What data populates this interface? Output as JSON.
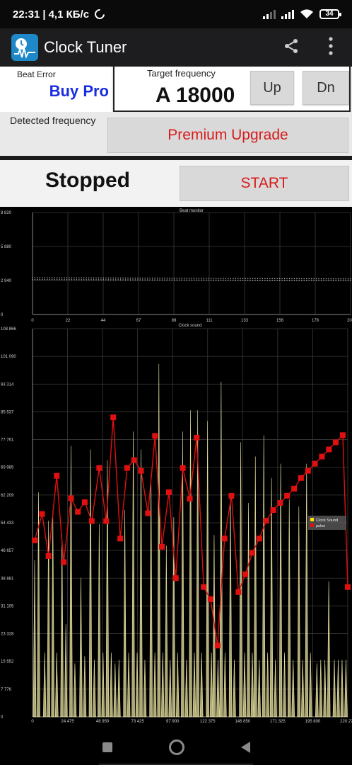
{
  "status_bar": {
    "time": "22:31",
    "net_speed": "4,1 КБ/с",
    "battery": "34"
  },
  "app": {
    "title": "Clock Tuner"
  },
  "controls": {
    "beat_error_label": "Beat Error",
    "buy_pro": "Buy Pro",
    "target_freq_label": "Target frequency",
    "target_freq_value": "A 18000",
    "up_label": "Up",
    "down_label": "Dn",
    "detected_freq_label": "Detected frequency",
    "premium_label": "Premium Upgrade",
    "state": "Stopped",
    "start_label": "START"
  },
  "colors": {
    "accent_red": "#d81b1b",
    "buy_pro_blue": "#1a2de0",
    "pulse": "#e01010",
    "clock_sound": "#e8e2a0"
  },
  "chart_data": [
    {
      "type": "scatter",
      "title": "Beat monitor",
      "x_ticks": [
        "0",
        "22",
        "44",
        "67",
        "89",
        "111",
        "133",
        "156",
        "178",
        "200"
      ],
      "y_ticks": [
        "8 820",
        "5 880",
        "2 940",
        "0"
      ],
      "xlim": [
        0,
        200
      ],
      "ylim": [
        0,
        8820
      ],
      "series": [
        {
          "values_start": 3180,
          "values_end": 3080
        },
        {
          "values_start": 3020,
          "values_end": 2940
        }
      ],
      "grid": true
    },
    {
      "type": "line",
      "title": "Clock sound",
      "x_ticks": [
        "0",
        "24 475",
        "48 950",
        "73 425",
        "97 900",
        "122 375",
        "146 850",
        "171 325",
        "195 800",
        "220 275"
      ],
      "y_ticks": [
        "108 866",
        "101 090",
        "93 314",
        "85 537",
        "77 761",
        "69 985",
        "62 209",
        "54 433",
        "46 657",
        "38 881",
        "31 105",
        "23 328",
        "15 552",
        "7 776",
        "0"
      ],
      "xlim": [
        0,
        220275
      ],
      "ylim": [
        0,
        108866
      ],
      "legend": {
        "position": "right",
        "entries": [
          "Clock Sound",
          "pulse"
        ]
      },
      "series": [
        {
          "name": "Clock Sound",
          "x": [
            1500,
            4200,
            8500,
            11200,
            14200,
            16900,
            20600,
            23300,
            26900,
            29600,
            33800,
            36500,
            40500,
            43200,
            46600,
            49300,
            52300,
            55000,
            57700,
            60400,
            64500,
            67200,
            70400,
            73100,
            75800,
            78500,
            82800,
            85500,
            88300,
            91000,
            93500,
            96200,
            98700,
            101400,
            104900,
            107600,
            110400,
            113100,
            115400,
            118100,
            122300,
            125000,
            126900,
            129600,
            131800,
            134500,
            138300,
            141000,
            145500,
            148200,
            150900,
            153600,
            155700,
            158400,
            161600,
            164300,
            167000,
            169700,
            173400,
            176100,
            179400,
            182100,
            186100,
            188800,
            191500,
            194200,
            198700,
            201400,
            204300,
            207000,
            210900,
            213600,
            216300,
            219000
          ],
          "values": [
            44000,
            63000,
            18000,
            55000,
            58000,
            18000,
            51000,
            26000,
            76000,
            15000,
            39000,
            17000,
            75000,
            16000,
            54000,
            18000,
            72000,
            18000,
            15000,
            16000,
            58000,
            18000,
            80000,
            18000,
            75000,
            16000,
            68000,
            18000,
            99000,
            18000,
            48000,
            16000,
            56000,
            18000,
            80000,
            16000,
            86000,
            18000,
            86000,
            18000,
            83000,
            18000,
            51000,
            16000,
            94000,
            18000,
            62000,
            16000,
            77000,
            18000,
            60000,
            18000,
            73000,
            16000,
            79000,
            18000,
            67000,
            16000,
            71000,
            18000,
            61000,
            16000,
            59000,
            16000,
            71000,
            18000,
            15000,
            16000,
            16000,
            38000,
            16000,
            16000,
            16000,
            16000
          ]
        },
        {
          "name": "pulse",
          "x": [
            1500,
            6700,
            11200,
            16900,
            21800,
            26900,
            31700,
            36500,
            41400,
            46600,
            51500,
            56400,
            61300,
            66100,
            71000,
            75800,
            80700,
            85600,
            90400,
            95300,
            100100,
            105000,
            109900,
            114700,
            119600,
            124400,
            129300,
            134200,
            139000,
            143900,
            148700,
            153600,
            158500,
            163300,
            168200,
            173000,
            177900,
            182800,
            187600,
            192500,
            197300,
            202200,
            207100,
            211900,
            216800,
            220275
          ],
          "values": [
            49500,
            56900,
            45100,
            67600,
            43400,
            61300,
            57500,
            60200,
            54900,
            69800,
            54900,
            84000,
            50000,
            69800,
            72000,
            69000,
            57100,
            78800,
            47700,
            63000,
            38900,
            69800,
            61200,
            78300,
            36400,
            33000,
            20000,
            50000,
            62000,
            35000,
            40000,
            46000,
            50000,
            55000,
            58000,
            60000,
            62000,
            64000,
            67000,
            69000,
            71000,
            73000,
            75000,
            77000,
            79000,
            36400
          ]
        }
      ],
      "grid": true
    }
  ]
}
